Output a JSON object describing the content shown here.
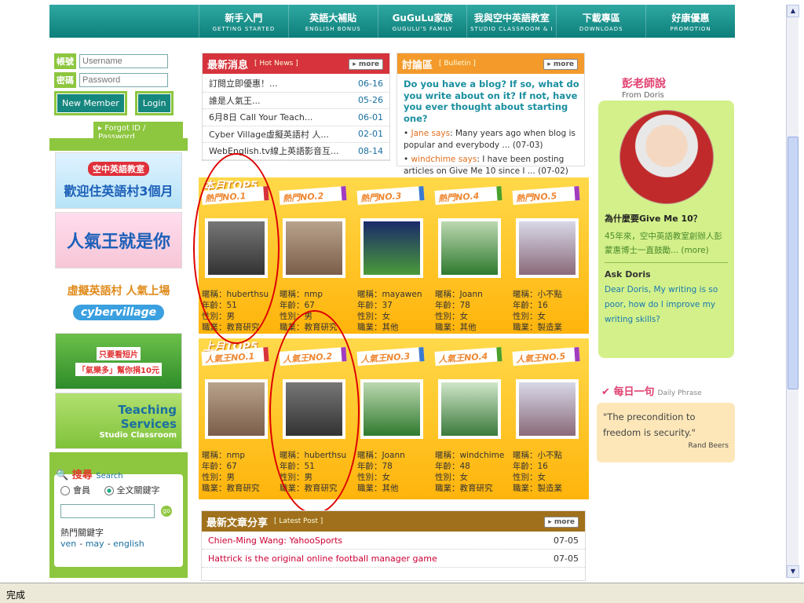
{
  "nav": [
    {
      "zh": "新手入門",
      "en": "GETTING STARTED"
    },
    {
      "zh": "英語大補貼",
      "en": "ENGLISH BONUS"
    },
    {
      "zh": "GuGuLu家族",
      "en": "GUGULU'S FAMILY"
    },
    {
      "zh": "我與空中英語教室",
      "en": "STUDIO CLASSROOM & I"
    },
    {
      "zh": "下載專區",
      "en": "DOWNLOADS"
    },
    {
      "zh": "好康優惠",
      "en": "PROMOTION"
    }
  ],
  "login": {
    "user_label": "帳號",
    "pass_label": "密碼",
    "user_placeholder": "Username",
    "pass_placeholder": "Password",
    "new_member": "New Member",
    "login": "Login",
    "forgot": "Forgot ID / Password"
  },
  "banners": {
    "b1_line1": "空中英語教室",
    "b1_line2": "歡迎住英語村3個月",
    "b2": "人氣王就是你",
    "b3_line1": "虛擬英語村 人氣上場",
    "b3_line2": "cybervillage",
    "b4_line1": "只要看短片",
    "b4_line2": "「氣樂多」幫你捐10元",
    "b5_line1": "Teaching",
    "b5_line2": "Services",
    "b5_line3": "Studio Classroom"
  },
  "search": {
    "title": "搜尋",
    "title_en": "Search",
    "opt1": "會員",
    "opt2": "全文關鍵字",
    "hot_label": "熱門關鍵字",
    "keywords": [
      "ven",
      "may",
      "english"
    ]
  },
  "news": {
    "title": "最新消息",
    "title_en": "[ Hot News ]",
    "more": "more",
    "items": [
      {
        "t": "訂閱立即優惠！...",
        "d": "06-16"
      },
      {
        "t": "誰是人氣王...",
        "d": "05-26"
      },
      {
        "t": "6月8日 Call Your Teach...",
        "d": "06-01"
      },
      {
        "t": "Cyber Village虛擬英語村 人...",
        "d": "02-01"
      },
      {
        "t": "WebEnglish.tv線上英語影音互...",
        "d": "08-14"
      }
    ]
  },
  "bulletin": {
    "title": "討論區",
    "title_en": "[ Bulletin ]",
    "more": "more",
    "question": "Do you have a blog? If so, what do you write about on it? If not, have you ever thought about starting one?",
    "items": [
      {
        "who": "Jane says",
        "text": ": Many years ago when blog is popular and everybody ... (07-03)"
      },
      {
        "who": "windchime says",
        "text": ": I have been posting articles on Give Me 10 since I ... (07-02)"
      }
    ]
  },
  "top5_this": {
    "title": "本月TOP5",
    "cards": [
      {
        "tag": "熱門NO.1",
        "nick": "暱稱：huberthsu",
        "age": "年齡：51",
        "sex": "性別：男",
        "job": "職業：教育研究"
      },
      {
        "tag": "熱門NO.2",
        "nick": "暱稱：nmp",
        "age": "年齡：67",
        "sex": "性別：男",
        "job": "職業：教育研究"
      },
      {
        "tag": "熱門NO.3",
        "nick": "暱稱：mayawen",
        "age": "年齡：37",
        "sex": "性別：女",
        "job": "職業：其他"
      },
      {
        "tag": "熱門NO.4",
        "nick": "暱稱：Joann",
        "age": "年齡：78",
        "sex": "性別：女",
        "job": "職業：其他"
      },
      {
        "tag": "熱門NO.5",
        "nick": "暱稱：小不點",
        "age": "年齡：16",
        "sex": "性別：女",
        "job": "職業：製造業"
      }
    ]
  },
  "top5_last": {
    "title": "上月TOP5",
    "cards": [
      {
        "tag": "人氣王NO.1",
        "nick": "暱稱：nmp",
        "age": "年齡：67",
        "sex": "性別：男",
        "job": "職業：教育研究"
      },
      {
        "tag": "人氣王NO.2",
        "nick": "暱稱：huberthsu",
        "age": "年齡：51",
        "sex": "性別：男",
        "job": "職業：教育研究"
      },
      {
        "tag": "人氣王NO.3",
        "nick": "暱稱：Joann",
        "age": "年齡：78",
        "sex": "性別：女",
        "job": "職業：其他"
      },
      {
        "tag": "人氣王NO.4",
        "nick": "暱稱：windchime",
        "age": "年齡：48",
        "sex": "性別：女",
        "job": "職業：教育研究"
      },
      {
        "tag": "人氣王NO.5",
        "nick": "暱稱：小不點",
        "age": "年齡：16",
        "sex": "性別：女",
        "job": "職業：製造業"
      }
    ]
  },
  "posts": {
    "title": "最新文章分享",
    "title_en": "[ Latest Post ]",
    "more": "more",
    "items": [
      {
        "t": "Chien-Ming Wang: YahooSports",
        "d": "07-05"
      },
      {
        "t": "Hattrick is the original online football manager game",
        "d": "07-05"
      }
    ]
  },
  "doris": {
    "head": "彭老師說",
    "head_en": "From Doris",
    "q1": "為什麼要Give Me 10？",
    "a1": "45年來，空中英語教室創辦人彭蒙惠博士一直鼓勵... (more)",
    "q2": "Ask Doris",
    "a2": "Dear Doris, My writing is so poor, how do I improve my writing skills?"
  },
  "daily": {
    "title": "每日一句",
    "title_en": "Daily Phrase",
    "quote": "\"The precondition to freedom is security.\"",
    "author": "Rand Beers"
  },
  "status": "完成",
  "colors": {
    "nav": "#1a9490",
    "green": "#8dc63f",
    "news_red": "#d6333c",
    "bulletin_orange": "#f39a2b",
    "panel": "#ffc423",
    "posts_brown": "#a0701c"
  }
}
